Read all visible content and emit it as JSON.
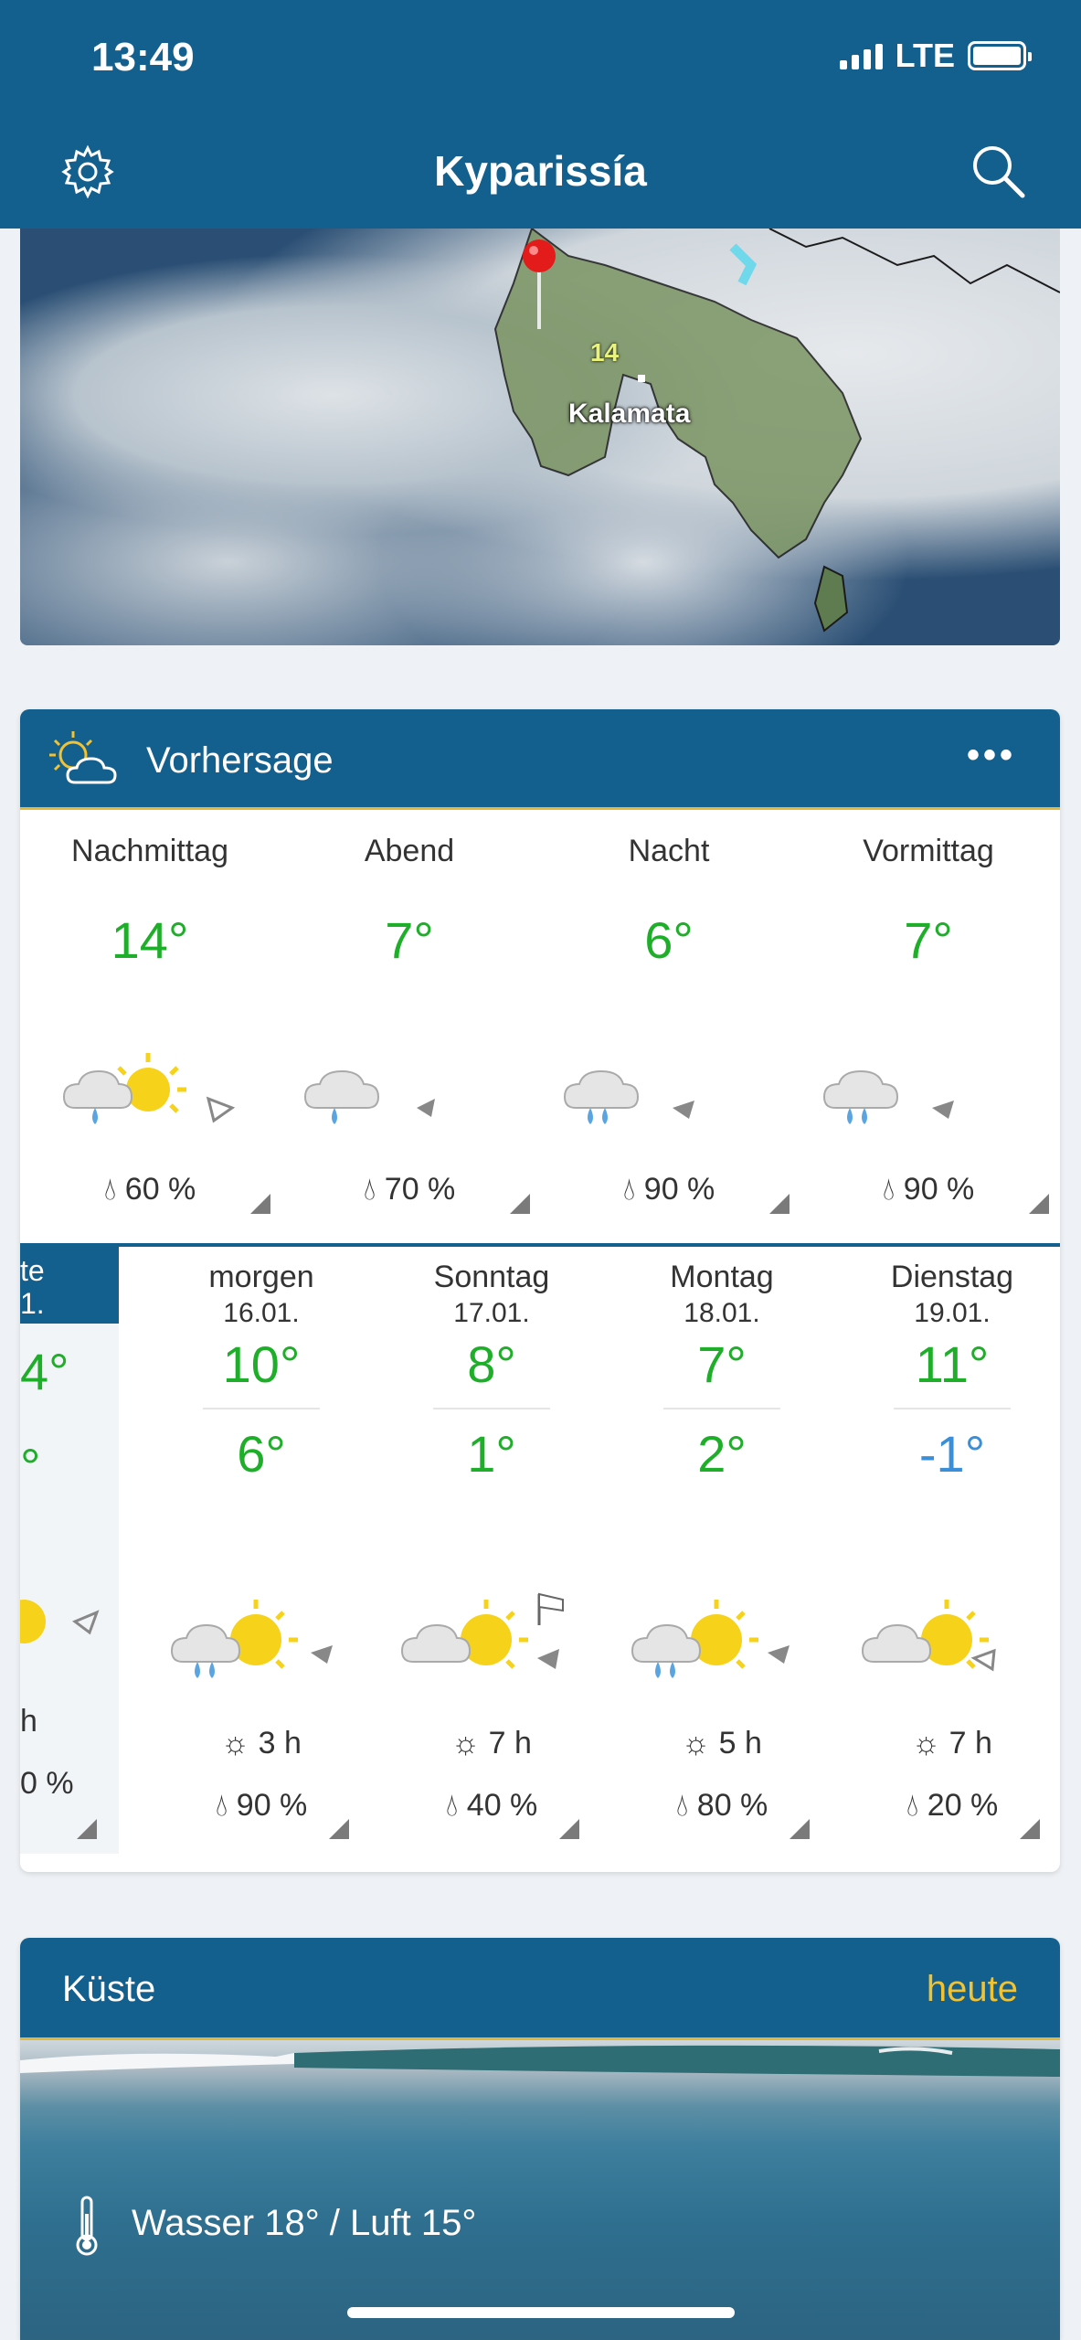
{
  "status": {
    "time": "13:49",
    "network": "LTE"
  },
  "header": {
    "title": "Kyparissía"
  },
  "map": {
    "city": "Kalamata",
    "temp": "14"
  },
  "forecast": {
    "title": "Vorhersage",
    "more": "•••",
    "periods": [
      {
        "label": "Nachmittag",
        "temp": "14°",
        "rain": "60 %"
      },
      {
        "label": "Abend",
        "temp": "7°",
        "rain": "70 %"
      },
      {
        "label": "Nacht",
        "temp": "6°",
        "rain": "90 %"
      },
      {
        "label": "Vormittag",
        "temp": "7°",
        "rain": "90 %"
      }
    ],
    "today": {
      "label_a": "te",
      "label_b": "1.",
      "max": "4°",
      "min": "°",
      "sun": "h",
      "rain": "0 %"
    },
    "days": [
      {
        "name": "morgen",
        "date": "16.01.",
        "max": "10°",
        "min": "6°",
        "sun": "3 h",
        "rain": "90 %"
      },
      {
        "name": "Sonntag",
        "date": "17.01.",
        "max": "8°",
        "min": "1°",
        "sun": "7 h",
        "rain": "40 %"
      },
      {
        "name": "Montag",
        "date": "18.01.",
        "max": "7°",
        "min": "2°",
        "sun": "5 h",
        "rain": "80 %"
      },
      {
        "name": "Dienstag",
        "date": "19.01.",
        "max": "11°",
        "min": "-1°",
        "sun": "7 h",
        "rain": "20 %"
      }
    ]
  },
  "coast": {
    "title": "Küste",
    "when": "heute",
    "water_air": "Wasser 18°  /  Luft 15°"
  },
  "colors": {
    "header": "#135f8e",
    "accent": "#e3b83a",
    "temp": "#1fae2a",
    "temp_negative": "#3a8fd8"
  }
}
